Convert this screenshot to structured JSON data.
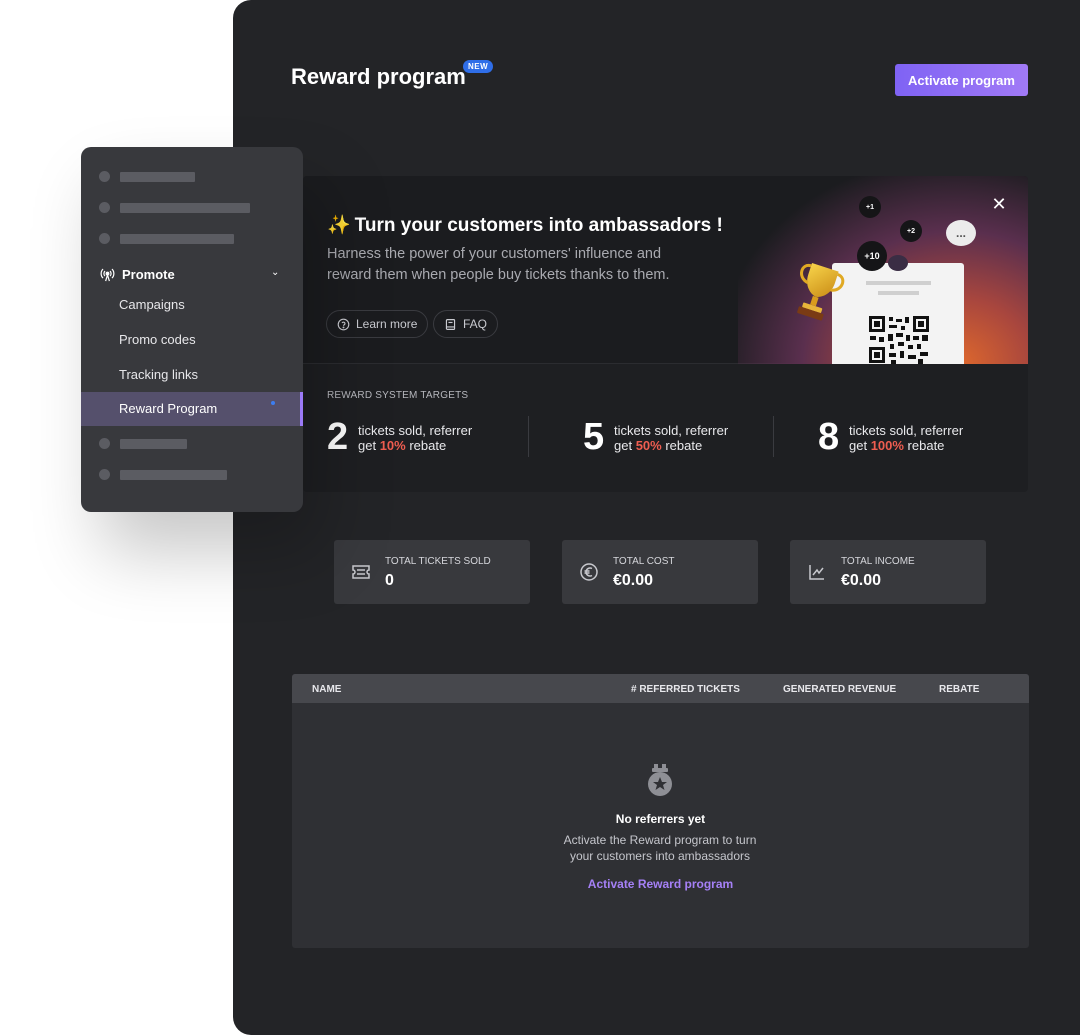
{
  "header": {
    "title": "Reward program",
    "badge": "NEW",
    "activate_label": "Activate program"
  },
  "banner": {
    "headline_icon": "✨",
    "headline": "Turn your customers into ambassadors !",
    "description": "Harness the power of your customers' influence and reward them when people buy tickets thanks to them.",
    "learn_more": "Learn more",
    "faq": "FAQ",
    "close_icon": "close-icon",
    "illustration": {
      "bubbles": [
        "+1",
        "+2",
        "+10"
      ],
      "speech": "..."
    }
  },
  "targets": {
    "title": "REWARD SYSTEM TARGETS",
    "items": [
      {
        "count": "2",
        "line1": "tickets sold, referrer",
        "line2_pre": "get ",
        "pct": "10%",
        "line2_post": " rebate"
      },
      {
        "count": "5",
        "line1": "tickets sold, referrer",
        "line2_pre": "get ",
        "pct": "50%",
        "line2_post": " rebate"
      },
      {
        "count": "8",
        "line1": "tickets sold, referrer",
        "line2_pre": "get ",
        "pct": "100%",
        "line2_post": " rebate"
      }
    ]
  },
  "stats": [
    {
      "label": "TOTAL TICKETS SOLD",
      "value": "0",
      "icon": "ticket-icon"
    },
    {
      "label": "TOTAL COST",
      "value": "€0.00",
      "icon": "euro-icon"
    },
    {
      "label": "TOTAL INCOME",
      "value": "€0.00",
      "icon": "chart-icon"
    }
  ],
  "table": {
    "columns": [
      "NAME",
      "# REFERRED TICKETS",
      "GENERATED REVENUE",
      "REBATE"
    ],
    "empty_title": "No referrers yet",
    "empty_desc": "Activate the Reward program to turn your customers into ambassadors",
    "empty_link": "Activate Reward program"
  },
  "sidebar": {
    "section": "Promote",
    "items": [
      {
        "label": "Campaigns"
      },
      {
        "label": "Promo codes"
      },
      {
        "label": "Tracking links"
      },
      {
        "label": "Reward Program",
        "active": true
      }
    ]
  },
  "colors": {
    "accent": "#8b6cf5",
    "highlight_pct": "#ee5d50",
    "badge": "#2f6ee8",
    "panel": "#232427"
  }
}
